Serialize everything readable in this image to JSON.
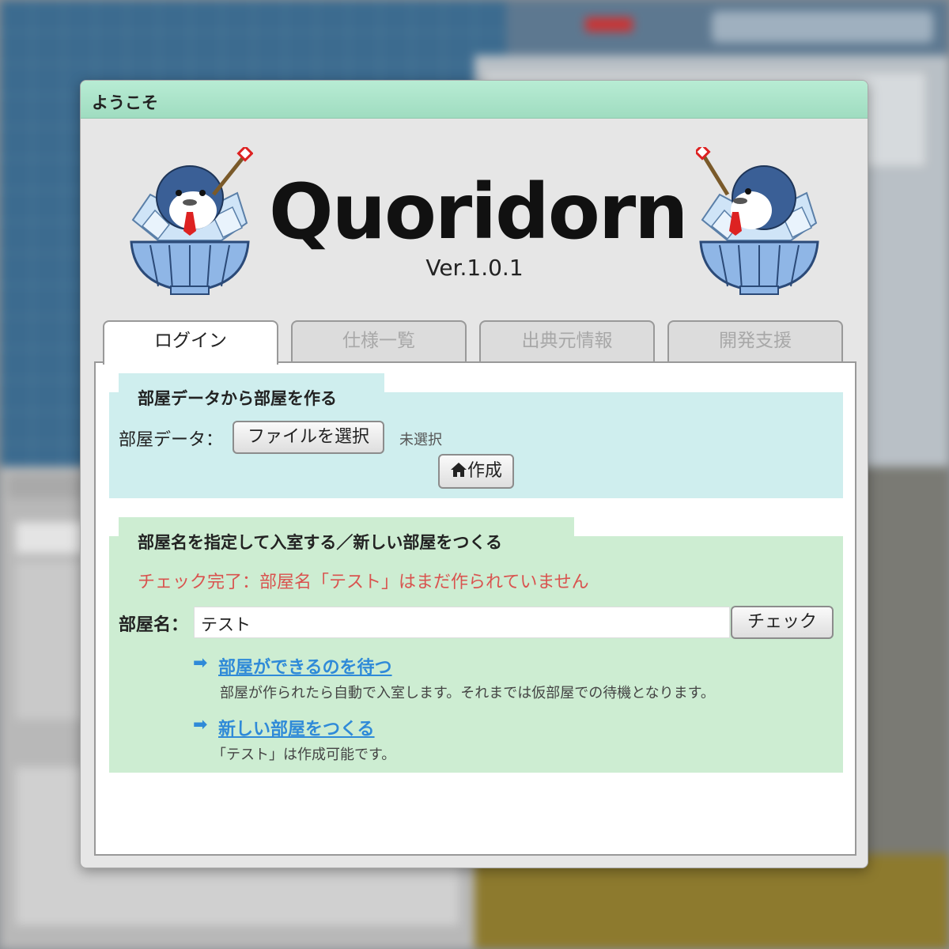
{
  "dialog": {
    "title": "ようこそ",
    "logo": "Quoridorn",
    "version": "Ver.1.0.1"
  },
  "tabs": [
    {
      "label": "ログイン",
      "active": true
    },
    {
      "label": "仕様一覧",
      "active": false
    },
    {
      "label": "出典元情報",
      "active": false
    },
    {
      "label": "開発支援",
      "active": false
    }
  ],
  "create_section": {
    "title": "部屋データから部屋を作る",
    "room_data_label": "部屋データ：",
    "file_button": "ファイルを選択",
    "file_status": "未選択",
    "create_button": "作成",
    "create_icon": "home-icon"
  },
  "enter_section": {
    "title": "部屋名を指定して入室する／新しい部屋をつくる",
    "status_message": "チェック完了：部屋名「テスト」はまだ作られていません",
    "room_name_label": "部屋名：",
    "room_name_value": "テスト",
    "check_button": "チェック",
    "wait_link": "部屋ができるのを待つ",
    "wait_desc": "部屋が作られたら自動で入室します。それまでは仮部屋での待機となります。",
    "new_link": "新しい部屋をつくる",
    "new_desc": "「テスト」は作成可能です。",
    "link_icon": "arrow-right-icon"
  },
  "colors": {
    "titlebar": "#a8e4c8",
    "section_create_bg": "#cfeeee",
    "section_enter_bg": "#cdedd2",
    "warning": "#d9534f",
    "link": "#2f8ad8"
  }
}
